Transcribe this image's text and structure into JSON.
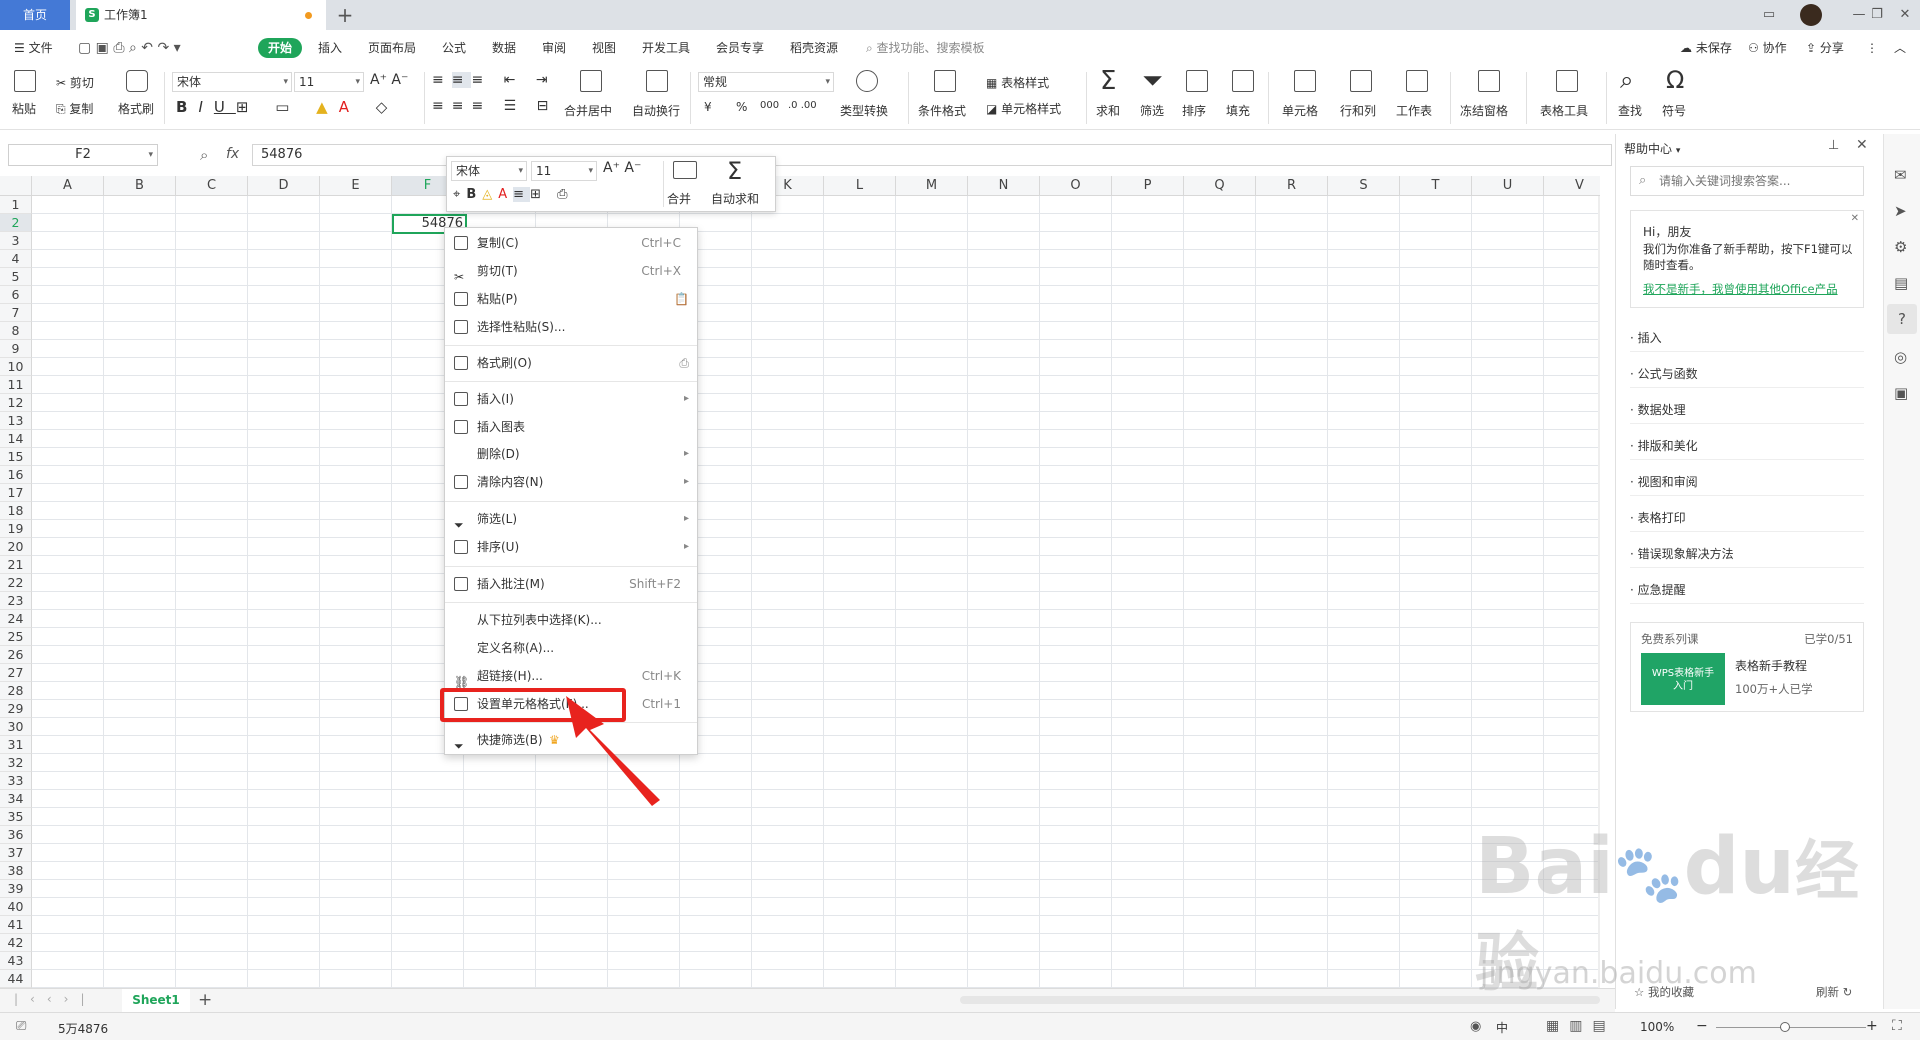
{
  "titlebar": {
    "home_tab": "首页",
    "doc_tab": "工作簿1",
    "doc_icon": "S",
    "add_tab": "+"
  },
  "menubar": {
    "file": "文件",
    "items": [
      "开始",
      "插入",
      "页面布局",
      "公式",
      "数据",
      "审阅",
      "视图",
      "开发工具",
      "会员专享",
      "稻壳资源"
    ],
    "search": "查找功能、搜索模板",
    "unsaved": "未保存",
    "collab": "协作",
    "share": "分享"
  },
  "toolbar": {
    "cut": "剪切",
    "paste": "粘贴",
    "copy": "复制",
    "format_painter": "格式刷",
    "font_name": "宋体",
    "font_size": "11",
    "number_format": "常规",
    "merge_center": "合并居中",
    "wrap": "自动换行",
    "type_convert": "类型转换",
    "cond_format": "条件格式",
    "table_style": "表格样式",
    "cell_style": "单元格样式",
    "sum": "求和",
    "filter": "筛选",
    "sort": "排序",
    "fill": "填充",
    "cell": "单元格",
    "rowcol": "行和列",
    "worksheet": "工作表",
    "freeze": "冻结窗格",
    "table_tools": "表格工具",
    "find": "查找",
    "symbol": "符号",
    "currency": "¥",
    "percent": "%",
    "thousands": "000"
  },
  "formula": {
    "name_box": "F2",
    "fx": "fx",
    "value": "54876"
  },
  "grid": {
    "columns": [
      "A",
      "B",
      "C",
      "D",
      "E",
      "F",
      "G",
      "H",
      "I",
      "J",
      "K",
      "L",
      "M",
      "N",
      "O",
      "P",
      "Q",
      "R",
      "S",
      "T",
      "U",
      "V"
    ],
    "rows": [
      "1",
      "2",
      "3",
      "4",
      "5",
      "6",
      "7",
      "8",
      "9",
      "10",
      "11",
      "12",
      "13",
      "14",
      "15",
      "16",
      "17",
      "18",
      "19",
      "20",
      "21",
      "22",
      "23",
      "24",
      "25",
      "26",
      "27",
      "28",
      "29",
      "30",
      "31",
      "32",
      "33",
      "34",
      "35",
      "36",
      "37",
      "38",
      "39",
      "40",
      "41",
      "42",
      "43",
      "44"
    ],
    "selected_value": "54876"
  },
  "mini_toolbar": {
    "font": "宋体",
    "size": "11",
    "merge": "合并",
    "autosum": "自动求和"
  },
  "context_menu": {
    "copy": {
      "label": "复制(C)",
      "shortcut": "Ctrl+C"
    },
    "cut": {
      "label": "剪切(T)",
      "shortcut": "Ctrl+X"
    },
    "paste": {
      "label": "粘贴(P)"
    },
    "paste_special": {
      "label": "选择性粘贴(S)..."
    },
    "format_painter": {
      "label": "格式刷(O)"
    },
    "insert": {
      "label": "插入(I)"
    },
    "insert_chart": {
      "label": "插入图表"
    },
    "delete": {
      "label": "删除(D)"
    },
    "clear": {
      "label": "清除内容(N)"
    },
    "filter": {
      "label": "筛选(L)"
    },
    "sort": {
      "label": "排序(U)"
    },
    "comment": {
      "label": "插入批注(M)",
      "shortcut": "Shift+F2"
    },
    "pick_list": {
      "label": "从下拉列表中选择(K)..."
    },
    "define_name": {
      "label": "定义名称(A)..."
    },
    "hyperlink": {
      "label": "超链接(H)...",
      "shortcut": "Ctrl+K"
    },
    "format_cells": {
      "label": "设置单元格格式(F)...",
      "shortcut": "Ctrl+1"
    },
    "quick_filter": {
      "label": "快捷筛选(B)"
    }
  },
  "help": {
    "title": "帮助中心",
    "search_placeholder": "请输入关键词搜索答案...",
    "greeting": "Hi，朋友",
    "intro": "我们为你准备了新手帮助，按下F1键可以随时查看。",
    "link": "我不是新手，我曾使用其他Office产品",
    "items": [
      "插入",
      "公式与函数",
      "数据处理",
      "排版和美化",
      "视图和审阅",
      "表格打印",
      "错误现象解决方法",
      "应急提醒"
    ],
    "course_title": "免费系列课",
    "course_progress": "已学0/51",
    "course_thumb": "WPS表格新手入门",
    "course_name": "表格新手教程",
    "course_count": "100万+人已学",
    "favorites": "我的收藏",
    "refresh": "刷新"
  },
  "sheets": {
    "active": "Sheet1",
    "add": "+"
  },
  "status": {
    "value": "5万4876",
    "zoom": "100%",
    "lang": "中"
  },
  "watermark": {
    "brand": "Bai",
    "brand2": "du",
    "cn": "经验",
    "url": "jingyan.baidu.com"
  },
  "colors": {
    "accent": "#1fa55a",
    "home_tab": "#4479d6",
    "highlight": "#e8231e",
    "link": "#1fa55a"
  }
}
